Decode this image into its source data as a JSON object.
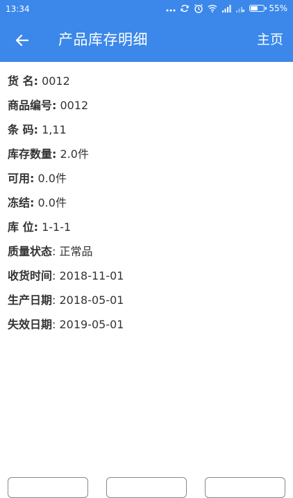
{
  "status_bar": {
    "time": "13:34",
    "battery_percent": "55%",
    "battery_level": 0.55,
    "icons": [
      "more-dots-icon",
      "sync-icon",
      "alarm-icon",
      "wifi-icon",
      "signal-icon",
      "signal-off-icon",
      "battery-icon"
    ]
  },
  "app_bar": {
    "title": "产品库存明细",
    "home_label": "主页",
    "back_icon": "back-arrow-icon",
    "color": "#3b88ea"
  },
  "details": [
    {
      "label": "货  名:",
      "value": " 0012"
    },
    {
      "label": "商品编号:",
      "value": " 0012"
    },
    {
      "label": "条  码:",
      "value": " 1,11"
    },
    {
      "label": "库存数量:",
      "value": " 2.0件"
    },
    {
      "label": "可用:",
      "value": " 0.0件"
    },
    {
      "label": "冻结:",
      "value": " 0.0件"
    },
    {
      "label": "库  位:",
      "value": " 1-1-1"
    },
    {
      "label": "质量状态",
      "value": ": 正常品"
    },
    {
      "label": "收货时间",
      "value": ": 2018-11-01"
    },
    {
      "label": "生产日期",
      "value": ": 2018-05-01"
    },
    {
      "label": "失效日期",
      "value": ": 2019-05-01"
    }
  ]
}
